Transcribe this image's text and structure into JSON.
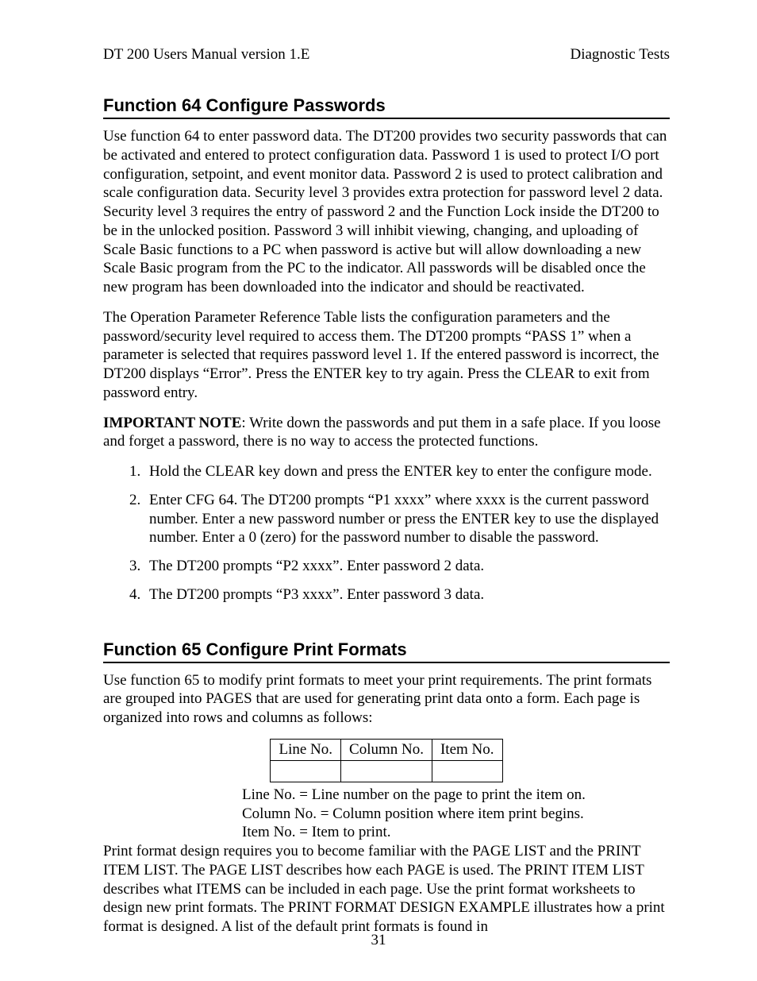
{
  "header": {
    "left": "DT 200 Users Manual version 1.E",
    "right": "Diagnostic Tests"
  },
  "section1": {
    "title": "Function 64 Configure Passwords",
    "p1": "Use function 64 to enter password data.  The DT200 provides two security passwords that can be activated and entered to protect configuration data.  Password 1 is used to protect I/O port configuration, setpoint, and event monitor data.  Password 2 is used to protect calibration and scale configuration data.  Security level 3 provides extra protection for password level 2 data.  Security level 3 requires the entry of password 2 and the Function Lock inside the DT200 to be in the unlocked position. Password 3 will inhibit viewing, changing, and uploading of Scale Basic functions to a PC when password is active but will allow downloading a new Scale Basic program from the PC to the indicator. All passwords will be disabled once the new program has been downloaded into the indicator and should be reactivated.",
    "p2": "The Operation Parameter Reference Table lists the configuration parameters and the password/security level required to access them.  The DT200 prompts “PASS 1” when a parameter is selected that requires password level 1.  If the entered password is incorrect, the DT200 displays “Error”.  Press the ENTER key to try again.  Press the CLEAR to exit from password entry.",
    "note_label": "IMPORTANT NOTE",
    "note_body": ":  Write down the passwords and put them in a safe place.  If you loose and forget a password, there is no way to access the protected functions.",
    "steps": [
      "Hold the CLEAR key down and press the ENTER key to enter the configure mode.",
      "Enter CFG 64.  The DT200 prompts “P1 xxxx” where xxxx is the current password number.  Enter a new password number or press the ENTER key to use the displayed number.  Enter a 0 (zero) for the password number to disable the password.",
      "The DT200 prompts “P2 xxxx”.  Enter password 2 data.",
      "The DT200 prompts “P3 xxxx”.  Enter password 3 data."
    ]
  },
  "section2": {
    "title": "Function 65 Configure Print Formats",
    "p1": "Use function 65 to modify print formats to meet your print requirements. The print formats are grouped into PAGES that are used for generating print data onto a form.  Each page is organized into rows and columns as follows:",
    "table_headers": [
      "Line No.",
      "Column No.",
      "Item No."
    ],
    "legend": [
      "Line No. = Line number on the page to print the item on.",
      "Column No. = Column position where item print begins.",
      "Item No. = Item to print."
    ],
    "p2": "Print format design requires you to become familiar with the PAGE LIST and the PRINT ITEM LIST.  The PAGE LIST describes how each PAGE is used.  The PRINT ITEM LIST describes what ITEMS can be included in each page.   Use the print format worksheets to design new print formats.  The PRINT FORMAT DESIGN EXAMPLE illustrates how a print format is designed.  A list of the default print formats is found in"
  },
  "page_number": "31"
}
